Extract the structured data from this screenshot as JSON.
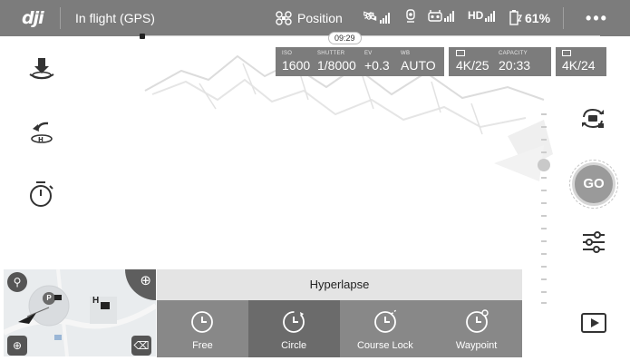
{
  "topbar": {
    "logo": "dji",
    "status": "In flight (GPS)",
    "flight_mode": "Position",
    "flight_time": "09:29",
    "video_link": "HD",
    "battery": "61%",
    "more": "•••"
  },
  "camera": {
    "iso_label": "ISO",
    "iso": "1600",
    "shutter_label": "SHUTTER",
    "shutter": "1/8000",
    "ev_label": "EV",
    "ev": "+0.3",
    "wb_label": "WB",
    "wb": "AUTO",
    "capacity_label": "CAPACITY",
    "resolution": "4K/25",
    "capacity": "20:33",
    "video_format": "4K/24"
  },
  "go_button": "GO",
  "hyperlapse": {
    "title": "Hyperlapse",
    "modes": [
      {
        "label": "Free",
        "selected": false
      },
      {
        "label": "Circle",
        "selected": true
      },
      {
        "label": "Course Lock",
        "selected": false
      },
      {
        "label": "Waypoint",
        "selected": false
      }
    ]
  },
  "map": {
    "home_label": "H",
    "aircraft_label": "P"
  },
  "icons": {
    "left": [
      "auto-land-icon",
      "return-home-icon",
      "timer-icon"
    ],
    "right": [
      "camera-switch-icon",
      "go-button",
      "settings-sliders-icon",
      "playback-icon"
    ]
  },
  "colors": {
    "bar": "#7c7c7c",
    "panel": "#888888",
    "selected": "#6b6b6b"
  }
}
